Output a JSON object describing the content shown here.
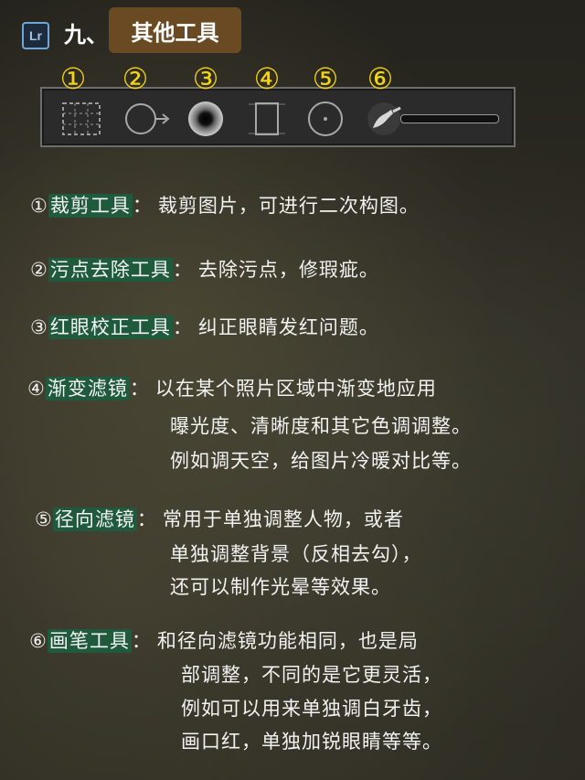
{
  "header": {
    "logo_text": "Lr",
    "prefix": "九、",
    "title": "其他工具"
  },
  "toolbar": {
    "numbers": [
      "①",
      "②",
      "③",
      "④",
      "⑤",
      "⑥"
    ],
    "icons": [
      "crop-icon",
      "spot-removal-icon",
      "red-eye-icon",
      "graduated-filter-icon",
      "radial-filter-icon",
      "brush-icon"
    ]
  },
  "items": [
    {
      "num": "①",
      "name": "裁剪工具",
      "sep": "：",
      "lines": [
        "裁剪图片，可进行二次构图。"
      ]
    },
    {
      "num": "②",
      "name": "污点去除工具",
      "sep": "：",
      "lines": [
        "去除污点，修瑕疵。"
      ]
    },
    {
      "num": "③",
      "name": "红眼校正工具",
      "sep": "：",
      "lines": [
        "纠正眼睛发红问题。"
      ]
    },
    {
      "num": "④",
      "name": "渐变滤镜",
      "sep": "：",
      "lines": [
        "以在某个照片区域中渐变地应用",
        "曝光度、清晰度和其它色调调整。",
        "例如调天空，给图片冷暖对比等。"
      ]
    },
    {
      "num": "⑤",
      "name": "径向滤镜",
      "sep": "：",
      "lines": [
        "常用于单独调整人物，或者",
        "单独调整背景（反相去勾），",
        "还可以制作光晕等效果。"
      ]
    },
    {
      "num": "⑥",
      "name": "画笔工具",
      "sep": "：",
      "lines": [
        "和径向滤镜功能相同，也是局",
        "部调整，不同的是它更灵活，",
        "例如可以用来单独调白牙齿，",
        "画口红，单独加锐眼睛等等。"
      ]
    }
  ]
}
